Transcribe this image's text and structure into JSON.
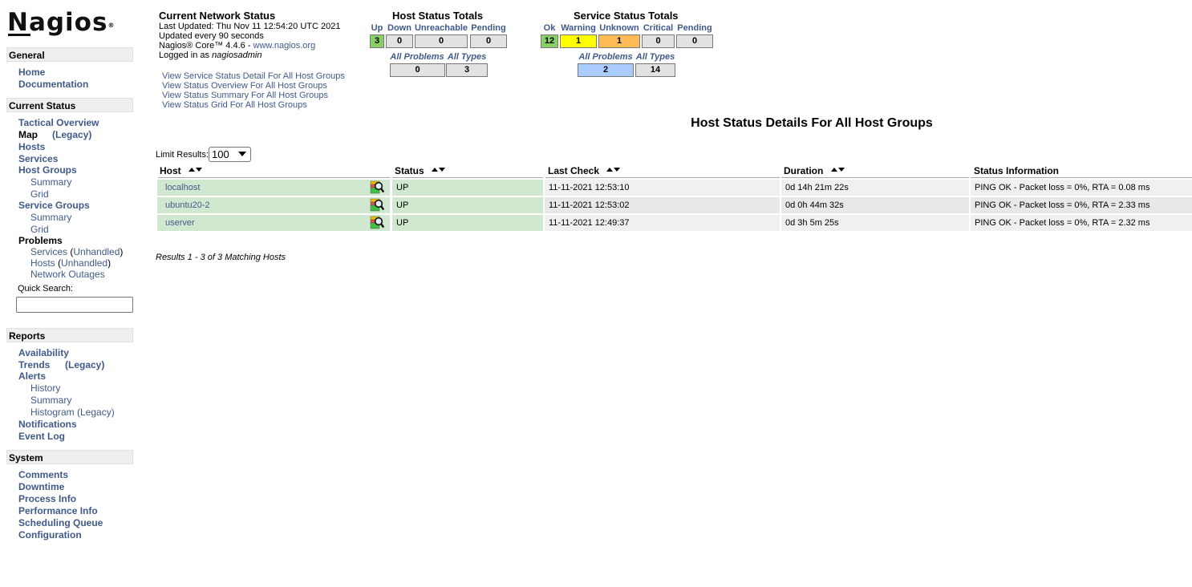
{
  "brand": {
    "name": "Nagios",
    "reg": "®"
  },
  "sidebar": {
    "general": {
      "title": "General",
      "items": [
        "Home",
        "Documentation"
      ]
    },
    "current_status": {
      "title": "Current Status",
      "tactical": "Tactical Overview",
      "map": "Map",
      "map_legacy": "(Legacy)",
      "hosts": "Hosts",
      "services": "Services",
      "host_groups": "Host Groups",
      "hg_summary": "Summary",
      "hg_grid": "Grid",
      "service_groups": "Service Groups",
      "sg_summary": "Summary",
      "sg_grid": "Grid",
      "problems": "Problems",
      "prob_services": "Services",
      "prob_hosts": "Hosts",
      "unhandled": "Unhandled",
      "network_outages": "Network Outages",
      "quick_search_label": "Quick Search:"
    },
    "reports": {
      "title": "Reports",
      "availability": "Availability",
      "trends": "Trends",
      "trends_legacy": "(Legacy)",
      "alerts": "Alerts",
      "history": "History",
      "summary": "Summary",
      "histogram": "Histogram (Legacy)",
      "notifications": "Notifications",
      "event_log": "Event Log"
    },
    "system": {
      "title": "System",
      "items": [
        "Comments",
        "Downtime",
        "Process Info",
        "Performance Info",
        "Scheduling Queue",
        "Configuration"
      ]
    }
  },
  "network_status": {
    "title": "Current Network Status",
    "last_updated": "Last Updated: Thu Nov 11 12:54:20 UTC 2021",
    "updated_every": "Updated every 90 seconds",
    "version_prefix": "Nagios® Core™ 4.4.6 - ",
    "version_link": "www.nagios.org",
    "logged_in_prefix": "Logged in as ",
    "user": "nagiosadmin",
    "links": [
      "View Service Status Detail For All Host Groups",
      "View Status Overview For All Host Groups",
      "View Status Summary For All Host Groups",
      "View Status Grid For All Host Groups"
    ]
  },
  "host_totals": {
    "title": "Host Status Totals",
    "headers": [
      "Up",
      "Down",
      "Unreachable",
      "Pending"
    ],
    "values": [
      "3",
      "0",
      "0",
      "0"
    ],
    "sub_headers": [
      "All Problems",
      "All Types"
    ],
    "sub_values": [
      "0",
      "3"
    ]
  },
  "service_totals": {
    "title": "Service Status Totals",
    "headers": [
      "Ok",
      "Warning",
      "Unknown",
      "Critical",
      "Pending"
    ],
    "values": [
      "12",
      "1",
      "1",
      "0",
      "0"
    ],
    "sub_headers": [
      "All Problems",
      "All Types"
    ],
    "sub_values": [
      "2",
      "14"
    ]
  },
  "colors": {
    "up": "#88d066",
    "warning": "#ffff00",
    "unknown": "#ffbb55",
    "problems": "#aaccff",
    "link": "#3f5a8a"
  },
  "main": {
    "title": "Host Status Details For All Host Groups",
    "limit_label": "Limit Results:",
    "limit_value": "100",
    "columns": [
      "Host",
      "Status",
      "Last Check",
      "Duration",
      "Status Information"
    ],
    "rows": [
      {
        "host": "localhost",
        "status": "UP",
        "last_check": "11-11-2021 12:53:10",
        "duration": "0d 14h 21m 22s",
        "info": "PING OK - Packet loss = 0%, RTA = 0.08 ms"
      },
      {
        "host": "ubuntu20-2",
        "status": "UP",
        "last_check": "11-11-2021 12:53:02",
        "duration": "0d 0h 44m 32s",
        "info": "PING OK - Packet loss = 0%, RTA = 2.33 ms"
      },
      {
        "host": "userver",
        "status": "UP",
        "last_check": "11-11-2021 12:49:37",
        "duration": "0d 3h 5m 25s",
        "info": "PING OK - Packet loss = 0%, RTA = 2.32 ms"
      }
    ],
    "results": "Results 1 - 3 of 3 Matching Hosts"
  }
}
